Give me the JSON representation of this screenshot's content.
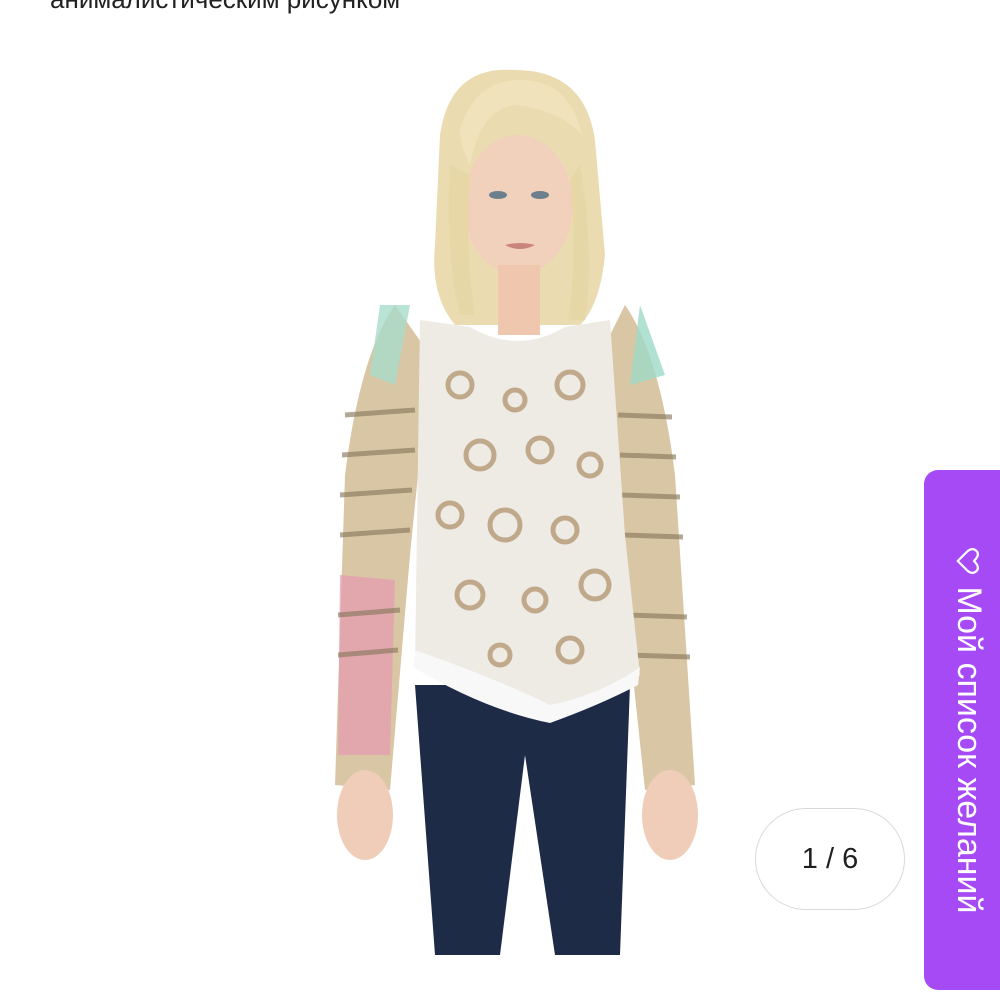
{
  "header": {
    "title_fragment": "анималистическим рисунком"
  },
  "product": {
    "image_icon": "product-photo-icon"
  },
  "gallery": {
    "counter": "1 / 6"
  },
  "wishlist": {
    "label": "Мой список желаний",
    "icon": "heart-outline-icon",
    "color": "#a64af5"
  }
}
